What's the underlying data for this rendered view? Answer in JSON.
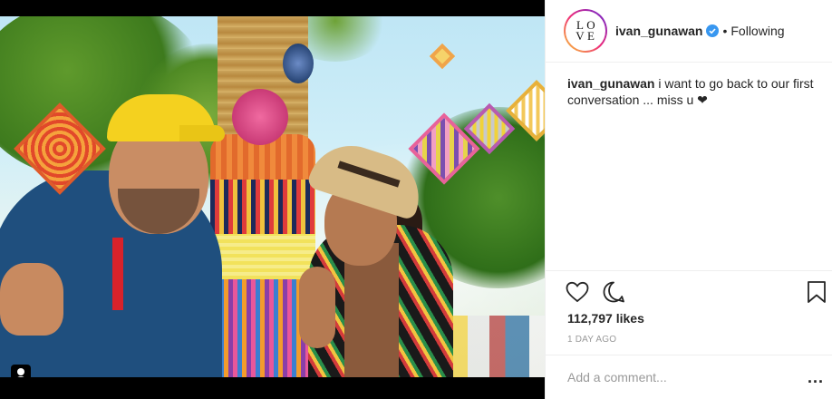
{
  "post": {
    "username": "ivan_gunawan",
    "follow_status": "Following",
    "separator": "•",
    "avatar_letters": [
      "L",
      "O",
      "V",
      "E"
    ],
    "caption": {
      "username": "ivan_gunawan",
      "text": "i want to go back to our first conversation ... miss u ❤"
    },
    "likes": "112,797 likes",
    "time": "1 DAY AGO",
    "comment_placeholder": "Add a comment...",
    "more_label": "..."
  },
  "icons": {
    "like": "heart-icon",
    "comment": "comment-icon",
    "save": "bookmark-icon",
    "verified": "verified-badge-icon",
    "user_tag": "user-tag-icon"
  },
  "colors": {
    "verified": "#3897f0",
    "text": "#262626",
    "muted": "#999999",
    "border": "#efefef"
  }
}
